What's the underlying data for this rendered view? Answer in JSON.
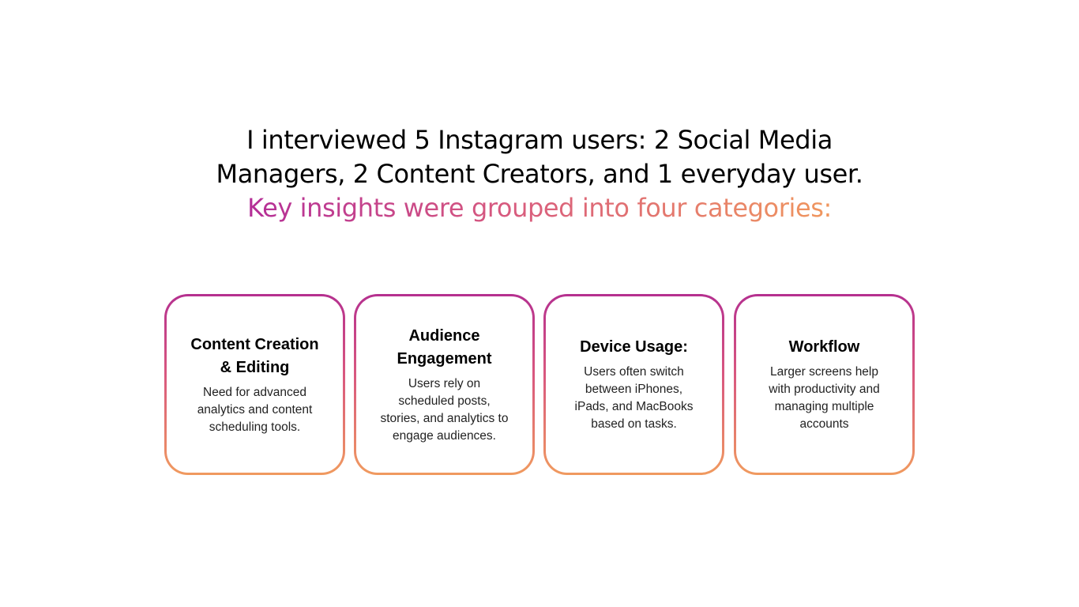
{
  "heading": {
    "line1": "I interviewed 5 Instagram users: 2 Social Media",
    "line2": "Managers, 2 Content Creators, and 1 everyday user.",
    "line3": "Key insights were grouped into four categories:"
  },
  "colors": {
    "gradient_start": "#b42e97",
    "gradient_mid": "#d85b7e",
    "gradient_end": "#f0975e",
    "text": "#000000",
    "background": "#ffffff"
  },
  "cards": [
    {
      "title": "Content Creation & Editing",
      "description": "Need for advanced analytics and content scheduling tools."
    },
    {
      "title": "Audience Engagement",
      "description": "Users rely on scheduled posts, stories, and analytics to engage audiences."
    },
    {
      "title": "Device Usage:",
      "description": "Users often switch between iPhones, iPads, and MacBooks based on tasks."
    },
    {
      "title": "Workflow",
      "description": "Larger screens help with productivity and managing multiple accounts"
    }
  ]
}
